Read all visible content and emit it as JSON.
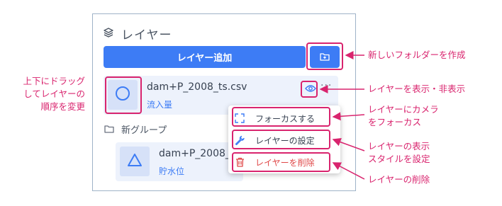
{
  "panel": {
    "title": "レイヤー",
    "add_layer_label": "レイヤー追加"
  },
  "layers": [
    {
      "name": "dam+P_2008_ts.csv",
      "subtitle": "流入量",
      "icon": "circle-icon"
    },
    {
      "name": "dam+P_2008_",
      "subtitle": "貯水位",
      "icon": "triangle-icon"
    }
  ],
  "group": {
    "name": "新グループ"
  },
  "more_label": "···",
  "context_menu": {
    "items": [
      {
        "label": "フォーカスする",
        "icon": "focus-icon"
      },
      {
        "label": "レイヤーの設定",
        "icon": "wrench-icon"
      },
      {
        "label": "レイヤーを削除",
        "icon": "trash-icon"
      }
    ]
  },
  "annotations": {
    "new_folder": "新しいフォルダーを作成",
    "toggle_visibility": "レイヤーを表示・非表示",
    "focus": [
      "レイヤーにカメラ",
      "をフォーカス"
    ],
    "settings": [
      "レイヤーの表示",
      "スタイルを設定"
    ],
    "delete": "レイヤーの削除",
    "drag": [
      "上下にドラッグ",
      "してレイヤーの",
      "順序を変更"
    ]
  },
  "colors": {
    "accent": "#3d7cf5",
    "highlight": "#d9246e",
    "delete": "#e04848"
  }
}
